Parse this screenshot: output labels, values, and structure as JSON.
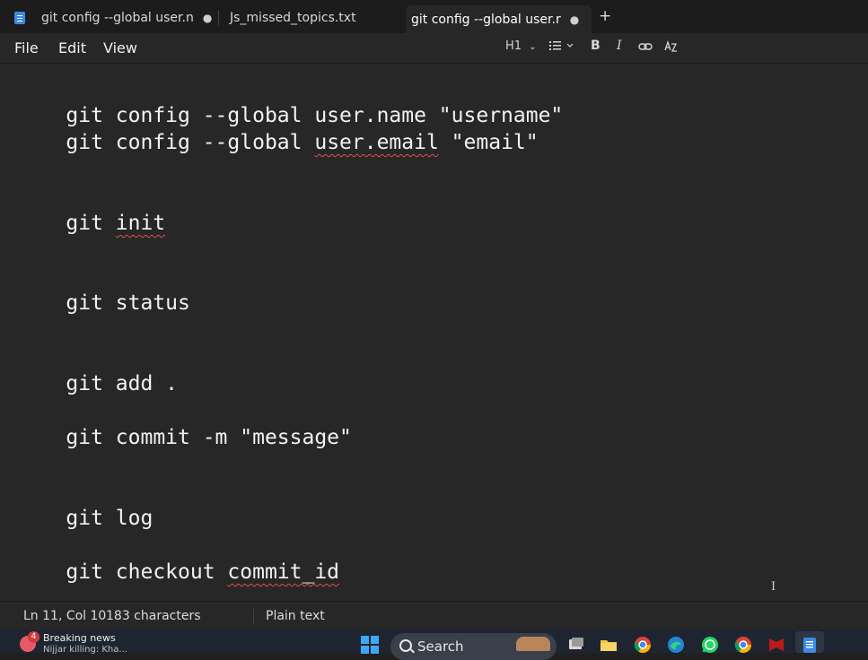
{
  "tabs": [
    {
      "label": "git config --global user.n",
      "modified_marker": "●"
    },
    {
      "label": "Js_missed_topics.txt"
    },
    {
      "label": "git config --global user.r",
      "modified_marker": "●",
      "active": true
    }
  ],
  "new_tab_label": "+",
  "menu": {
    "file": "File",
    "edit": "Edit",
    "view": "View"
  },
  "toolbar": {
    "heading": "H1"
  },
  "editor": {
    "lines": [
      {
        "parts": [
          "git config --global user.name \"username\""
        ]
      },
      {
        "parts": [
          "git config --global ",
          "user.email",
          " \"email\""
        ]
      },
      {
        "parts": [
          "git ",
          "init"
        ]
      },
      {
        "parts": [
          "git status"
        ]
      },
      {
        "parts": [
          "git add ."
        ]
      },
      {
        "parts": [
          "git commit -m \"message\""
        ]
      },
      {
        "parts": [
          "git log"
        ]
      },
      {
        "parts": [
          "git checkout ",
          "commit_id"
        ]
      }
    ],
    "cursor_glyph": "I"
  },
  "status": {
    "position": "Ln 11, Col 10",
    "characters": "183 characters",
    "format": "Plain text"
  },
  "taskbar": {
    "news_badge": "4",
    "news_title": "Breaking news",
    "news_subtitle": "Nijjar killing: Kha...",
    "search_label": "Search"
  },
  "colors": {
    "editor_bg": "#272727",
    "tab_bg": "#1c1c1c",
    "spell_underline": "#e34b4b",
    "accent": "#3b8be6",
    "taskbar_bg": "#1f2530"
  }
}
